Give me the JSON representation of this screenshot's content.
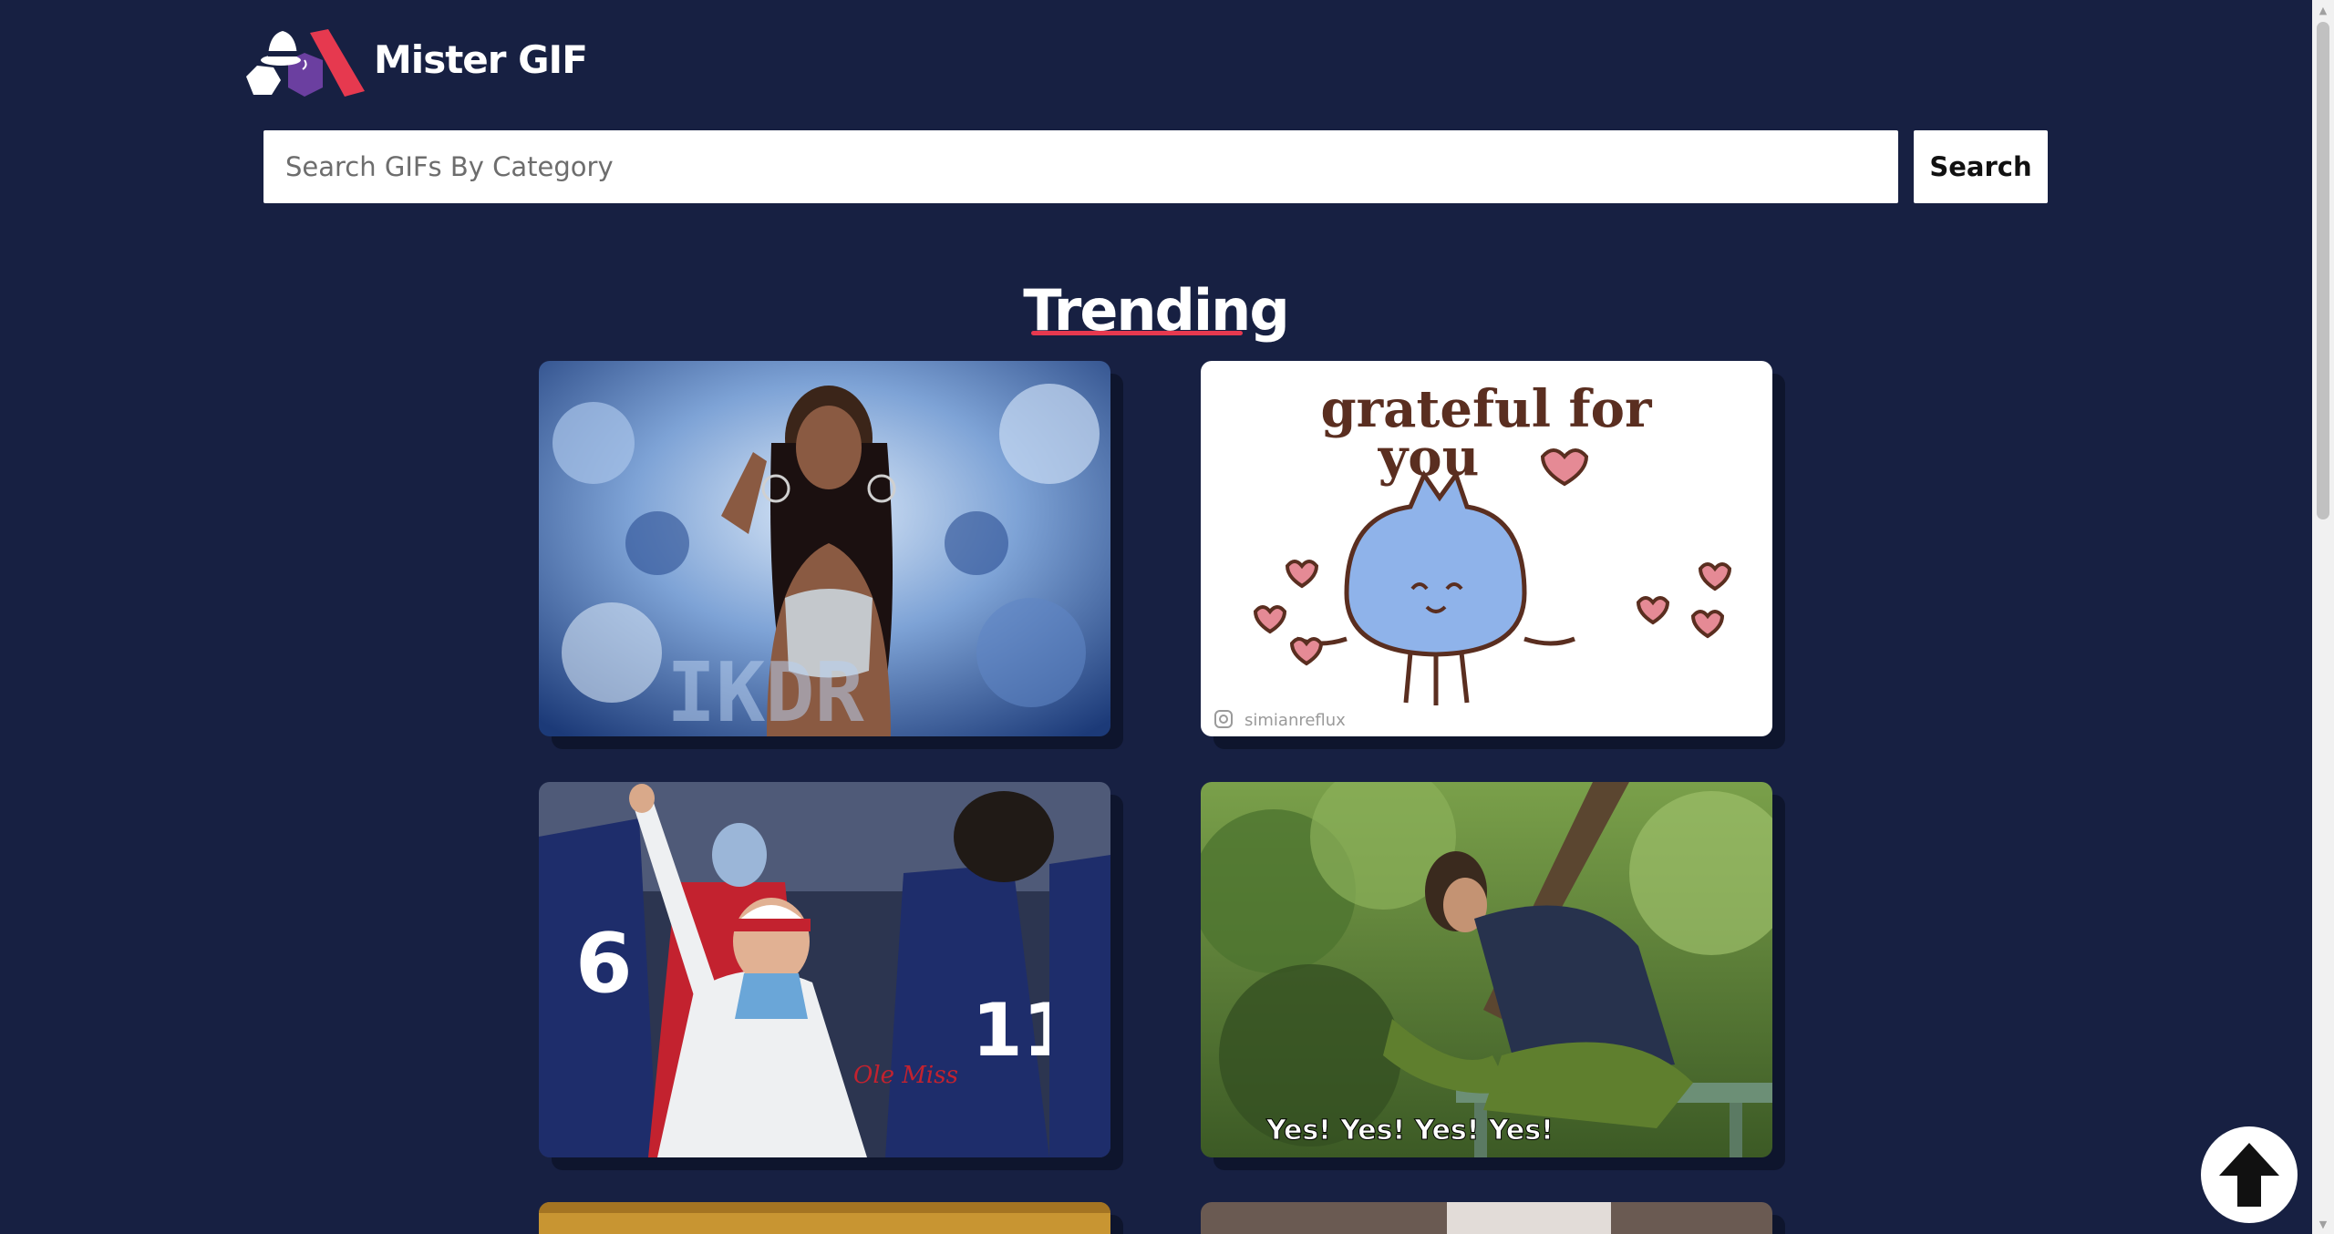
{
  "header": {
    "logo_text": "Mister GIF",
    "logo_icon": "detective-hat-logo-icon"
  },
  "search": {
    "placeholder": "Search GIFs By Category",
    "button_label": "Search"
  },
  "section": {
    "title": "Trending"
  },
  "gifs": [
    {
      "caption": "",
      "overlay_text": "IKDR",
      "theme": "woman-diamonds"
    },
    {
      "caption": "grateful for you",
      "watermark": "simianreflux",
      "theme": "cat-hearts"
    },
    {
      "caption": "",
      "theme": "football-coach"
    },
    {
      "caption": "Yes! Yes! Yes! Yes!",
      "theme": "man-bench"
    },
    {
      "caption": "",
      "theme": "partial"
    },
    {
      "caption": "",
      "theme": "partial"
    }
  ],
  "back_to_top": {
    "icon": "arrow-up-icon"
  },
  "colors": {
    "background": "#172042",
    "accent": "#e6394f",
    "logo_purple": "#6b3fa0",
    "logo_red": "#e6394f"
  }
}
